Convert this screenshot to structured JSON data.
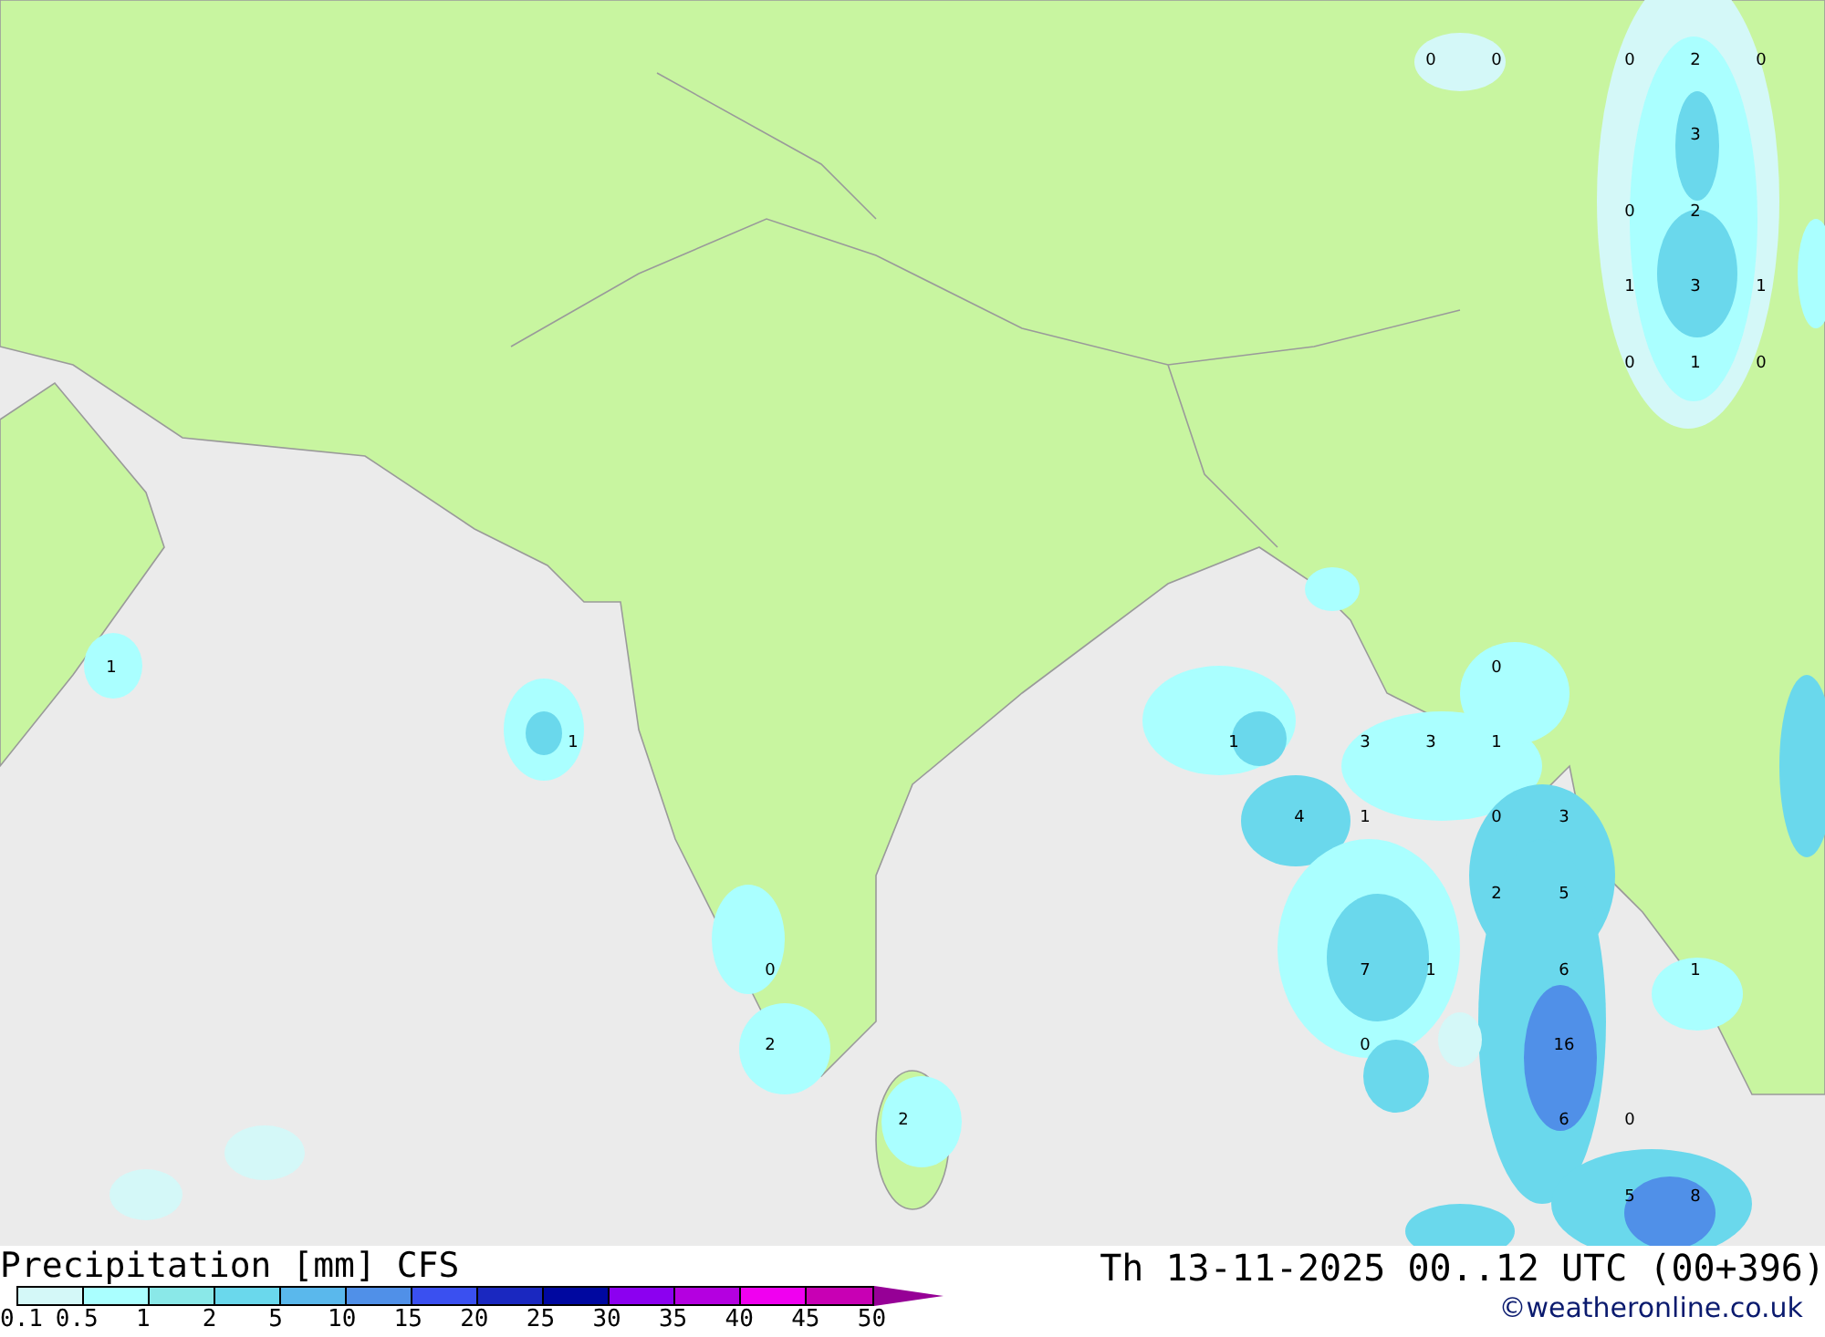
{
  "map_labels": [
    {
      "text": "0"
    },
    {
      "text": "0"
    },
    {
      "text": "0"
    },
    {
      "text": "2"
    },
    {
      "text": "0"
    },
    {
      "text": "3"
    },
    {
      "text": "0"
    },
    {
      "text": "2"
    },
    {
      "text": "1"
    },
    {
      "text": "3"
    },
    {
      "text": "1"
    },
    {
      "text": "0"
    },
    {
      "text": "1"
    },
    {
      "text": "0"
    },
    {
      "text": "1"
    },
    {
      "text": "1"
    },
    {
      "text": "0"
    },
    {
      "text": "1"
    },
    {
      "text": "3"
    },
    {
      "text": "3"
    },
    {
      "text": "1"
    },
    {
      "text": "4"
    },
    {
      "text": "1"
    },
    {
      "text": "0"
    },
    {
      "text": "3"
    },
    {
      "text": "2"
    },
    {
      "text": "5"
    },
    {
      "text": "0"
    },
    {
      "text": "7"
    },
    {
      "text": "1"
    },
    {
      "text": "6"
    },
    {
      "text": "1"
    },
    {
      "text": "2"
    },
    {
      "text": "0"
    },
    {
      "text": "16"
    },
    {
      "text": "2"
    },
    {
      "text": "6"
    },
    {
      "text": "0"
    },
    {
      "text": "5"
    },
    {
      "text": "8"
    }
  ],
  "title": "Precipitation [mm] CFS",
  "valid_time": "Th 13-11-2025 00..12 UTC (00+396)",
  "legend": {
    "segments": [
      {
        "color": "#d4f8f8"
      },
      {
        "color": "#aaffff"
      },
      {
        "color": "#8ae8e8"
      },
      {
        "color": "#6ad8ec"
      },
      {
        "color": "#5ab8ec"
      },
      {
        "color": "#5090e8"
      },
      {
        "color": "#3a50f0"
      },
      {
        "color": "#1a28c0"
      },
      {
        "color": "#0008a0"
      },
      {
        "color": "#8c00f0"
      },
      {
        "color": "#b400e0"
      },
      {
        "color": "#f000f0"
      },
      {
        "color": "#c800b4"
      },
      {
        "kind": "arrow",
        "color": "#960096"
      }
    ],
    "labels": [
      "0.1",
      "0.5",
      "1",
      "2",
      "5",
      "10",
      "15",
      "20",
      "25",
      "30",
      "35",
      "40",
      "45",
      "50"
    ]
  },
  "credit": "©weatheronline.co.uk"
}
